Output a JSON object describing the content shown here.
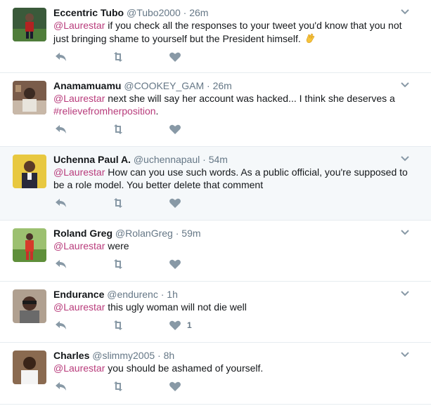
{
  "tweets": [
    {
      "name": "Eccentric Tubo",
      "handle": "@Tubo2000",
      "sep": "·",
      "time": "26m",
      "mention": "@Laurestar",
      "text": " if you check all the responses to your tweet you'd know that you not just bringing shame to yourself but the President himself.",
      "hashtag": "",
      "like_count": "",
      "emoji": "clapping-hands-emoji"
    },
    {
      "name": "Anamamuamu",
      "handle": "@COOKEY_GAM",
      "sep": "·",
      "time": "26m",
      "mention": "@Laurestar",
      "text": " next she will say her account was hacked... I think she deserves a ",
      "hashtag": "#relievefromherposition",
      "text_after": ".",
      "like_count": ""
    },
    {
      "name": "Uchenna Paul A.",
      "handle": "@uchennapaul",
      "sep": "·",
      "time": "54m",
      "mention": "@Laurestar",
      "text": " How can you use such  words. As a public official, you're supposed to be a role model. You better delete that comment",
      "hashtag": "",
      "like_count": ""
    },
    {
      "name": "Roland Greg",
      "handle": "@RolanGreg",
      "sep": "·",
      "time": "59m",
      "mention": "@Laurestar",
      "text": " were",
      "hashtag": "",
      "like_count": ""
    },
    {
      "name": "Endurance",
      "handle": "@endurenc",
      "sep": "·",
      "time": "1h",
      "mention": "@Laurestar",
      "text": " this ugly woman will not die well",
      "hashtag": "",
      "like_count": "1"
    },
    {
      "name": "Charles",
      "handle": "@slimmy2005",
      "sep": "·",
      "time": "8h",
      "mention": "@Laurestar",
      "text": " you should be ashamed of yourself.",
      "hashtag": "",
      "like_count": ""
    }
  ],
  "colors": {
    "mention": "#b83b7b",
    "icon": "#8899a6",
    "highlight": "#f5f8fa"
  }
}
